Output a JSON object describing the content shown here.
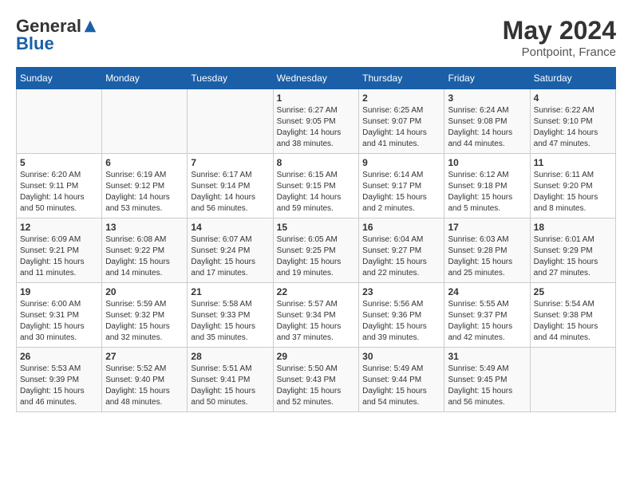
{
  "header": {
    "logo": {
      "general": "General",
      "blue": "Blue",
      "tagline": ""
    },
    "title": "May 2024",
    "location": "Pontpoint, France"
  },
  "weekdays": [
    "Sunday",
    "Monday",
    "Tuesday",
    "Wednesday",
    "Thursday",
    "Friday",
    "Saturday"
  ],
  "weeks": [
    [
      {
        "day": "",
        "info": ""
      },
      {
        "day": "",
        "info": ""
      },
      {
        "day": "",
        "info": ""
      },
      {
        "day": "1",
        "info": "Sunrise: 6:27 AM\nSunset: 9:05 PM\nDaylight: 14 hours\nand 38 minutes."
      },
      {
        "day": "2",
        "info": "Sunrise: 6:25 AM\nSunset: 9:07 PM\nDaylight: 14 hours\nand 41 minutes."
      },
      {
        "day": "3",
        "info": "Sunrise: 6:24 AM\nSunset: 9:08 PM\nDaylight: 14 hours\nand 44 minutes."
      },
      {
        "day": "4",
        "info": "Sunrise: 6:22 AM\nSunset: 9:10 PM\nDaylight: 14 hours\nand 47 minutes."
      }
    ],
    [
      {
        "day": "5",
        "info": "Sunrise: 6:20 AM\nSunset: 9:11 PM\nDaylight: 14 hours\nand 50 minutes."
      },
      {
        "day": "6",
        "info": "Sunrise: 6:19 AM\nSunset: 9:12 PM\nDaylight: 14 hours\nand 53 minutes."
      },
      {
        "day": "7",
        "info": "Sunrise: 6:17 AM\nSunset: 9:14 PM\nDaylight: 14 hours\nand 56 minutes."
      },
      {
        "day": "8",
        "info": "Sunrise: 6:15 AM\nSunset: 9:15 PM\nDaylight: 14 hours\nand 59 minutes."
      },
      {
        "day": "9",
        "info": "Sunrise: 6:14 AM\nSunset: 9:17 PM\nDaylight: 15 hours\nand 2 minutes."
      },
      {
        "day": "10",
        "info": "Sunrise: 6:12 AM\nSunset: 9:18 PM\nDaylight: 15 hours\nand 5 minutes."
      },
      {
        "day": "11",
        "info": "Sunrise: 6:11 AM\nSunset: 9:20 PM\nDaylight: 15 hours\nand 8 minutes."
      }
    ],
    [
      {
        "day": "12",
        "info": "Sunrise: 6:09 AM\nSunset: 9:21 PM\nDaylight: 15 hours\nand 11 minutes."
      },
      {
        "day": "13",
        "info": "Sunrise: 6:08 AM\nSunset: 9:22 PM\nDaylight: 15 hours\nand 14 minutes."
      },
      {
        "day": "14",
        "info": "Sunrise: 6:07 AM\nSunset: 9:24 PM\nDaylight: 15 hours\nand 17 minutes."
      },
      {
        "day": "15",
        "info": "Sunrise: 6:05 AM\nSunset: 9:25 PM\nDaylight: 15 hours\nand 19 minutes."
      },
      {
        "day": "16",
        "info": "Sunrise: 6:04 AM\nSunset: 9:27 PM\nDaylight: 15 hours\nand 22 minutes."
      },
      {
        "day": "17",
        "info": "Sunrise: 6:03 AM\nSunset: 9:28 PM\nDaylight: 15 hours\nand 25 minutes."
      },
      {
        "day": "18",
        "info": "Sunrise: 6:01 AM\nSunset: 9:29 PM\nDaylight: 15 hours\nand 27 minutes."
      }
    ],
    [
      {
        "day": "19",
        "info": "Sunrise: 6:00 AM\nSunset: 9:31 PM\nDaylight: 15 hours\nand 30 minutes."
      },
      {
        "day": "20",
        "info": "Sunrise: 5:59 AM\nSunset: 9:32 PM\nDaylight: 15 hours\nand 32 minutes."
      },
      {
        "day": "21",
        "info": "Sunrise: 5:58 AM\nSunset: 9:33 PM\nDaylight: 15 hours\nand 35 minutes."
      },
      {
        "day": "22",
        "info": "Sunrise: 5:57 AM\nSunset: 9:34 PM\nDaylight: 15 hours\nand 37 minutes."
      },
      {
        "day": "23",
        "info": "Sunrise: 5:56 AM\nSunset: 9:36 PM\nDaylight: 15 hours\nand 39 minutes."
      },
      {
        "day": "24",
        "info": "Sunrise: 5:55 AM\nSunset: 9:37 PM\nDaylight: 15 hours\nand 42 minutes."
      },
      {
        "day": "25",
        "info": "Sunrise: 5:54 AM\nSunset: 9:38 PM\nDaylight: 15 hours\nand 44 minutes."
      }
    ],
    [
      {
        "day": "26",
        "info": "Sunrise: 5:53 AM\nSunset: 9:39 PM\nDaylight: 15 hours\nand 46 minutes."
      },
      {
        "day": "27",
        "info": "Sunrise: 5:52 AM\nSunset: 9:40 PM\nDaylight: 15 hours\nand 48 minutes."
      },
      {
        "day": "28",
        "info": "Sunrise: 5:51 AM\nSunset: 9:41 PM\nDaylight: 15 hours\nand 50 minutes."
      },
      {
        "day": "29",
        "info": "Sunrise: 5:50 AM\nSunset: 9:43 PM\nDaylight: 15 hours\nand 52 minutes."
      },
      {
        "day": "30",
        "info": "Sunrise: 5:49 AM\nSunset: 9:44 PM\nDaylight: 15 hours\nand 54 minutes."
      },
      {
        "day": "31",
        "info": "Sunrise: 5:49 AM\nSunset: 9:45 PM\nDaylight: 15 hours\nand 56 minutes."
      },
      {
        "day": "",
        "info": ""
      }
    ]
  ]
}
